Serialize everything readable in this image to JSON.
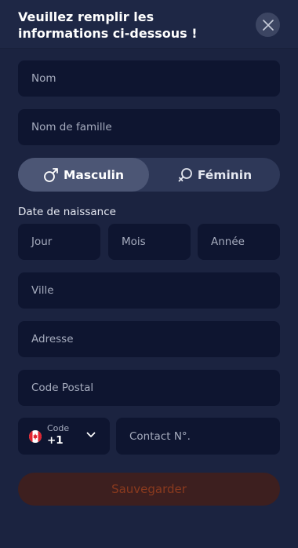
{
  "header": {
    "title": "Veuillez remplir les informations ci-dessous !",
    "close_icon": "close-icon"
  },
  "form": {
    "first_name_placeholder": "Nom",
    "last_name_placeholder": "Nom de famille",
    "gender": {
      "selected": "male",
      "male_label": "Masculin",
      "male_icon": "male-symbol-icon",
      "female_label": "Féminin",
      "female_icon": "female-symbol-icon"
    },
    "dob_label": "Date de naissance",
    "day_placeholder": "Jour",
    "month_placeholder": "Mois",
    "year_placeholder": "Année",
    "city_placeholder": "Ville",
    "address_placeholder": "Adresse",
    "postal_code_placeholder": "Code Postal",
    "phone": {
      "code_label": "Code",
      "code_value": "+1",
      "flag_icon": "canada-flag-icon",
      "chevron_icon": "chevron-down-icon",
      "contact_placeholder": "Contact N°."
    },
    "save_label": "Sauvegarder"
  },
  "colors": {
    "background": "#1b2340",
    "field": "#0e1530",
    "toggle_track": "#2e3858",
    "toggle_active": "#4c5675",
    "save_button": "#3d1f1f",
    "save_text": "#8a3a1e"
  }
}
